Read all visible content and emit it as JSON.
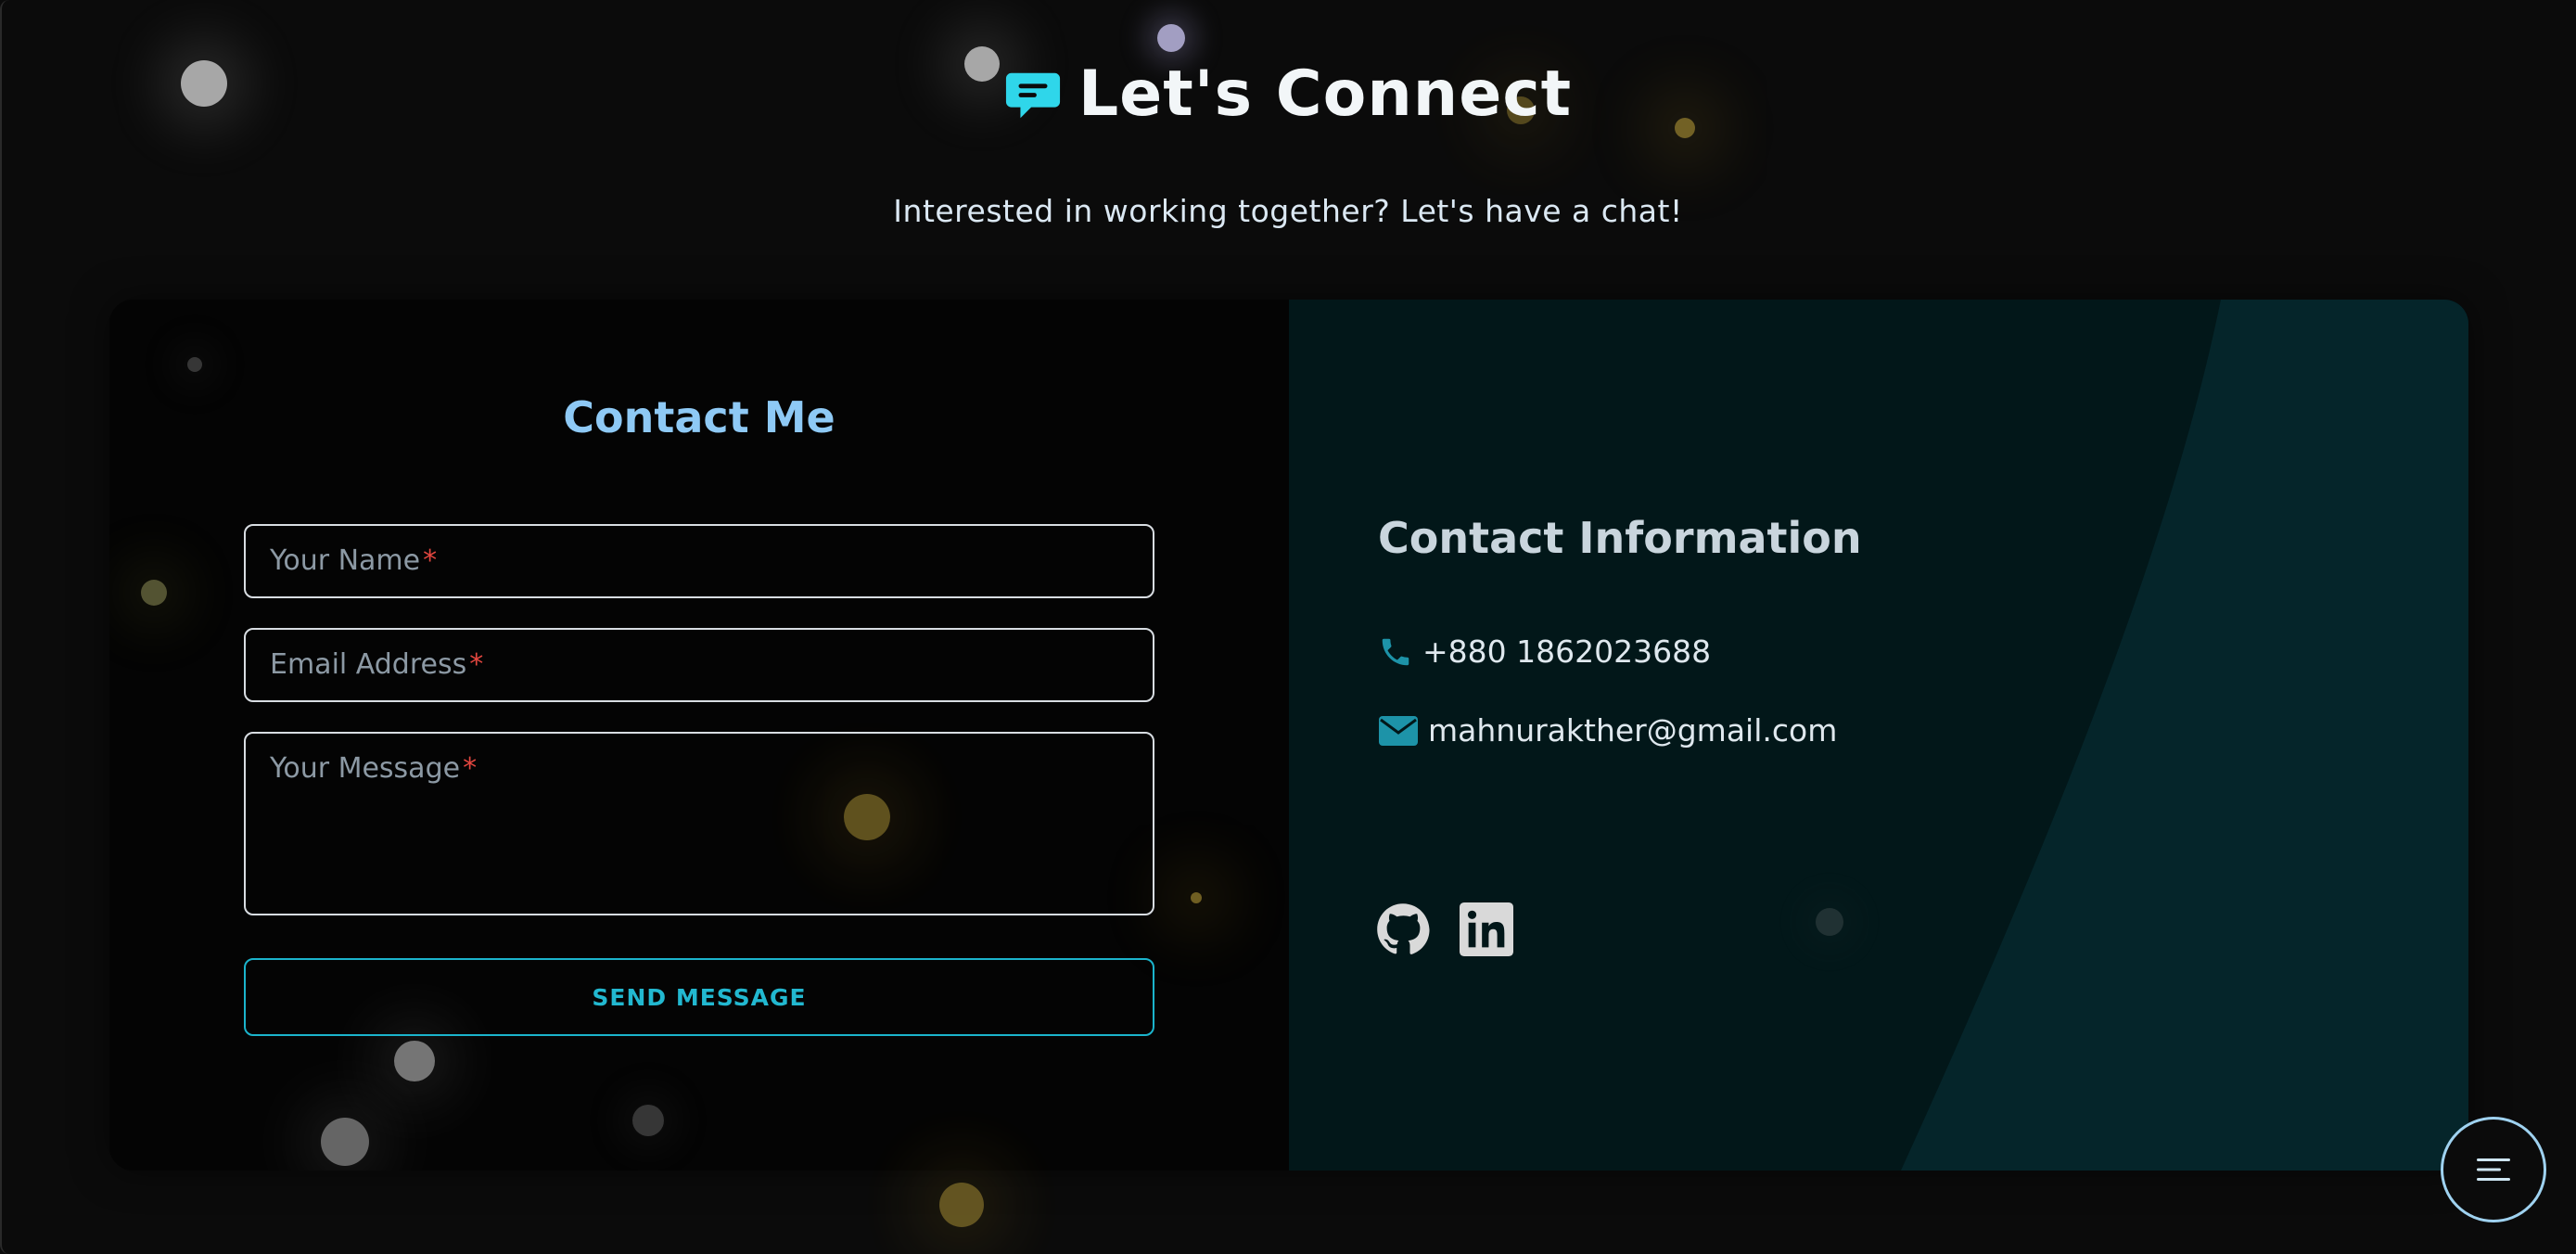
{
  "header": {
    "title": "Let's Connect",
    "icon": "chat-bubble-icon",
    "subtitle": "Interested in working together? Let's have a chat!"
  },
  "contact_form": {
    "title": "Contact Me",
    "name_placeholder": "Your Name",
    "email_placeholder": "Email Address",
    "message_placeholder": "Your Message",
    "required_marker": "*",
    "submit_label": "SEND MESSAGE"
  },
  "contact_info": {
    "title": "Contact Information",
    "phone": "+880 1862023688",
    "email": "mahnurakther@gmail.com",
    "social": [
      "github-icon",
      "linkedin-icon"
    ]
  },
  "menu_button": {
    "icon": "menu-icon"
  },
  "colors": {
    "accent": "#22b8d0",
    "heading_blue": "#8ec9f5",
    "required": "#e2463f",
    "panel_teal": "#021719",
    "background": "#0b0b0b"
  }
}
